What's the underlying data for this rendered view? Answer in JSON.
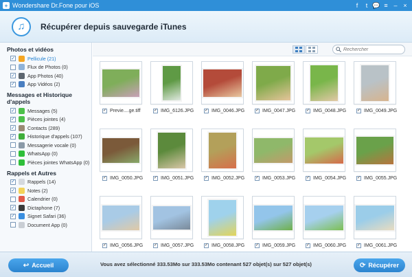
{
  "app": {
    "title": "Wondershare Dr.Fone pour iOS",
    "controls": [
      "f",
      "t",
      "💬",
      "≡",
      "–",
      "×"
    ]
  },
  "header": {
    "title": "Récupérer depuis sauvegarde iTunes"
  },
  "sidebar": {
    "sections": [
      {
        "title": "Photos et vidéos",
        "items": [
          {
            "label": "Pellicule (21)",
            "checked": true,
            "icon": "flower-icon",
            "color": "#f5a623",
            "active": true
          },
          {
            "label": "Flux de Photos (0)",
            "checked": false,
            "icon": "photo-stream-icon",
            "color": "#8fb3d9"
          },
          {
            "label": "App Photos (40)",
            "checked": true,
            "icon": "camera-icon",
            "color": "#5c6670"
          },
          {
            "label": "App Vidéos (2)",
            "checked": true,
            "icon": "film-icon",
            "color": "#4a7fc1"
          }
        ]
      },
      {
        "title": "Messages et Historique d'appels",
        "items": [
          {
            "label": "Messages (5)",
            "checked": true,
            "icon": "message-icon",
            "color": "#4cc04a"
          },
          {
            "label": "Pièces jointes (4)",
            "checked": true,
            "icon": "attachment-icon",
            "color": "#4cc04a"
          },
          {
            "label": "Contacts (289)",
            "checked": true,
            "icon": "contacts-icon",
            "color": "#9a8a74"
          },
          {
            "label": "Historique d'appels (107)",
            "checked": true,
            "icon": "phone-icon",
            "color": "#3fae3a"
          },
          {
            "label": "Messagerie vocale (0)",
            "checked": false,
            "icon": "voicemail-icon",
            "color": "#8a9aa8"
          },
          {
            "label": "WhatsApp (0)",
            "checked": false,
            "icon": "whatsapp-icon",
            "color": "#2fbf3a"
          },
          {
            "label": "Pièces jointes WhatsApp (0)",
            "checked": false,
            "icon": "whatsapp-attachment-icon",
            "color": "#2fbf3a"
          }
        ]
      },
      {
        "title": "Rappels et Autres",
        "items": [
          {
            "label": "Rappels (14)",
            "checked": true,
            "icon": "reminders-icon",
            "color": "#d5d9de"
          },
          {
            "label": "Notes (2)",
            "checked": true,
            "icon": "notes-icon",
            "color": "#f3d35a"
          },
          {
            "label": "Calendrier (0)",
            "checked": false,
            "icon": "calendar-icon",
            "color": "#e25a4a"
          },
          {
            "label": "Dictaphone (7)",
            "checked": true,
            "icon": "dictaphone-icon",
            "color": "#3b3b3b"
          },
          {
            "label": "Signet Safari (36)",
            "checked": true,
            "icon": "safari-icon",
            "color": "#3a8fe0"
          },
          {
            "label": "Document App (0)",
            "checked": false,
            "icon": "document-icon",
            "color": "#c9ced4"
          }
        ]
      }
    ]
  },
  "toolbar": {
    "search_placeholder": "Rechercher"
  },
  "photos": [
    {
      "name": "Previe....ge.tiff",
      "checked": true,
      "w": 58,
      "h": 44,
      "c1": "#7fae5a",
      "c2": "#c9a0b8"
    },
    {
      "name": "IMG_6126.JPG",
      "checked": true,
      "w": 30,
      "h": 54,
      "c1": "#5f9a45",
      "c2": "#dfe8e0"
    },
    {
      "name": "IMG_0046.JPG",
      "checked": true,
      "w": 60,
      "h": 44,
      "c1": "#b44b3a",
      "c2": "#e8c7a0"
    },
    {
      "name": "IMG_0047.JPG",
      "checked": true,
      "w": 54,
      "h": 54,
      "c1": "#7faa4a",
      "c2": "#e6c49a"
    },
    {
      "name": "IMG_0048.JPG",
      "checked": true,
      "w": 44,
      "h": 56,
      "c1": "#79b64a",
      "c2": "#e2c8a6"
    },
    {
      "name": "IMG_0049.JPG",
      "checked": true,
      "w": 44,
      "h": 56,
      "c1": "#b9c2c7",
      "c2": "#d7b48e"
    },
    {
      "name": "IMG_0050.JPG",
      "checked": true,
      "w": 58,
      "h": 40,
      "c1": "#7b5a3a",
      "c2": "#88a96a"
    },
    {
      "name": "IMG_0051.JPG",
      "checked": true,
      "w": 44,
      "h": 56,
      "c1": "#5c8a3c",
      "c2": "#d9c6a8"
    },
    {
      "name": "IMG_0052.JPG",
      "checked": true,
      "w": 44,
      "h": 56,
      "c1": "#b3a05a",
      "c2": "#d76e4a"
    },
    {
      "name": "IMG_0053.JPG",
      "checked": true,
      "w": 60,
      "h": 40,
      "c1": "#8fb86a",
      "c2": "#c39a6a"
    },
    {
      "name": "IMG_0054.JPG",
      "checked": true,
      "w": 60,
      "h": 42,
      "c1": "#a4c86a",
      "c2": "#d66a4a"
    },
    {
      "name": "IMG_0055.JPG",
      "checked": true,
      "w": 58,
      "h": 44,
      "c1": "#6aa14a",
      "c2": "#b8743e"
    },
    {
      "name": "IMG_0056.JPG",
      "checked": true,
      "w": 58,
      "h": 40,
      "c1": "#a9cbe6",
      "c2": "#e0c9a6"
    },
    {
      "name": "IMG_0057.JPG",
      "checked": true,
      "w": 58,
      "h": 38,
      "c1": "#a2c3e2",
      "c2": "#7a8a9a"
    },
    {
      "name": "IMG_0058.JPG",
      "checked": true,
      "w": 44,
      "h": 56,
      "c1": "#9fd2ec",
      "c2": "#e2d45a"
    },
    {
      "name": "IMG_0059.JPG",
      "checked": true,
      "w": 60,
      "h": 40,
      "c1": "#93c5ea",
      "c2": "#6fb04a"
    },
    {
      "name": "IMG_0060.JPG",
      "checked": true,
      "w": 60,
      "h": 40,
      "c1": "#a6d0ee",
      "c2": "#7cbf52"
    },
    {
      "name": "IMG_0061.JPG",
      "checked": true,
      "w": 60,
      "h": 40,
      "c1": "#9bcde9",
      "c2": "#e9dcc0"
    }
  ],
  "footer": {
    "back_label": "Accueil",
    "status": "Vous avez sélectionné 333.53Mo sur 333.53Mo contenant 527 objet(s) sur 527 objet(s)",
    "recover_label": "Récupérer"
  },
  "colors": {
    "titlebar": "#2f8fd8",
    "accent": "#3a97df",
    "button": "#2c84cf"
  }
}
